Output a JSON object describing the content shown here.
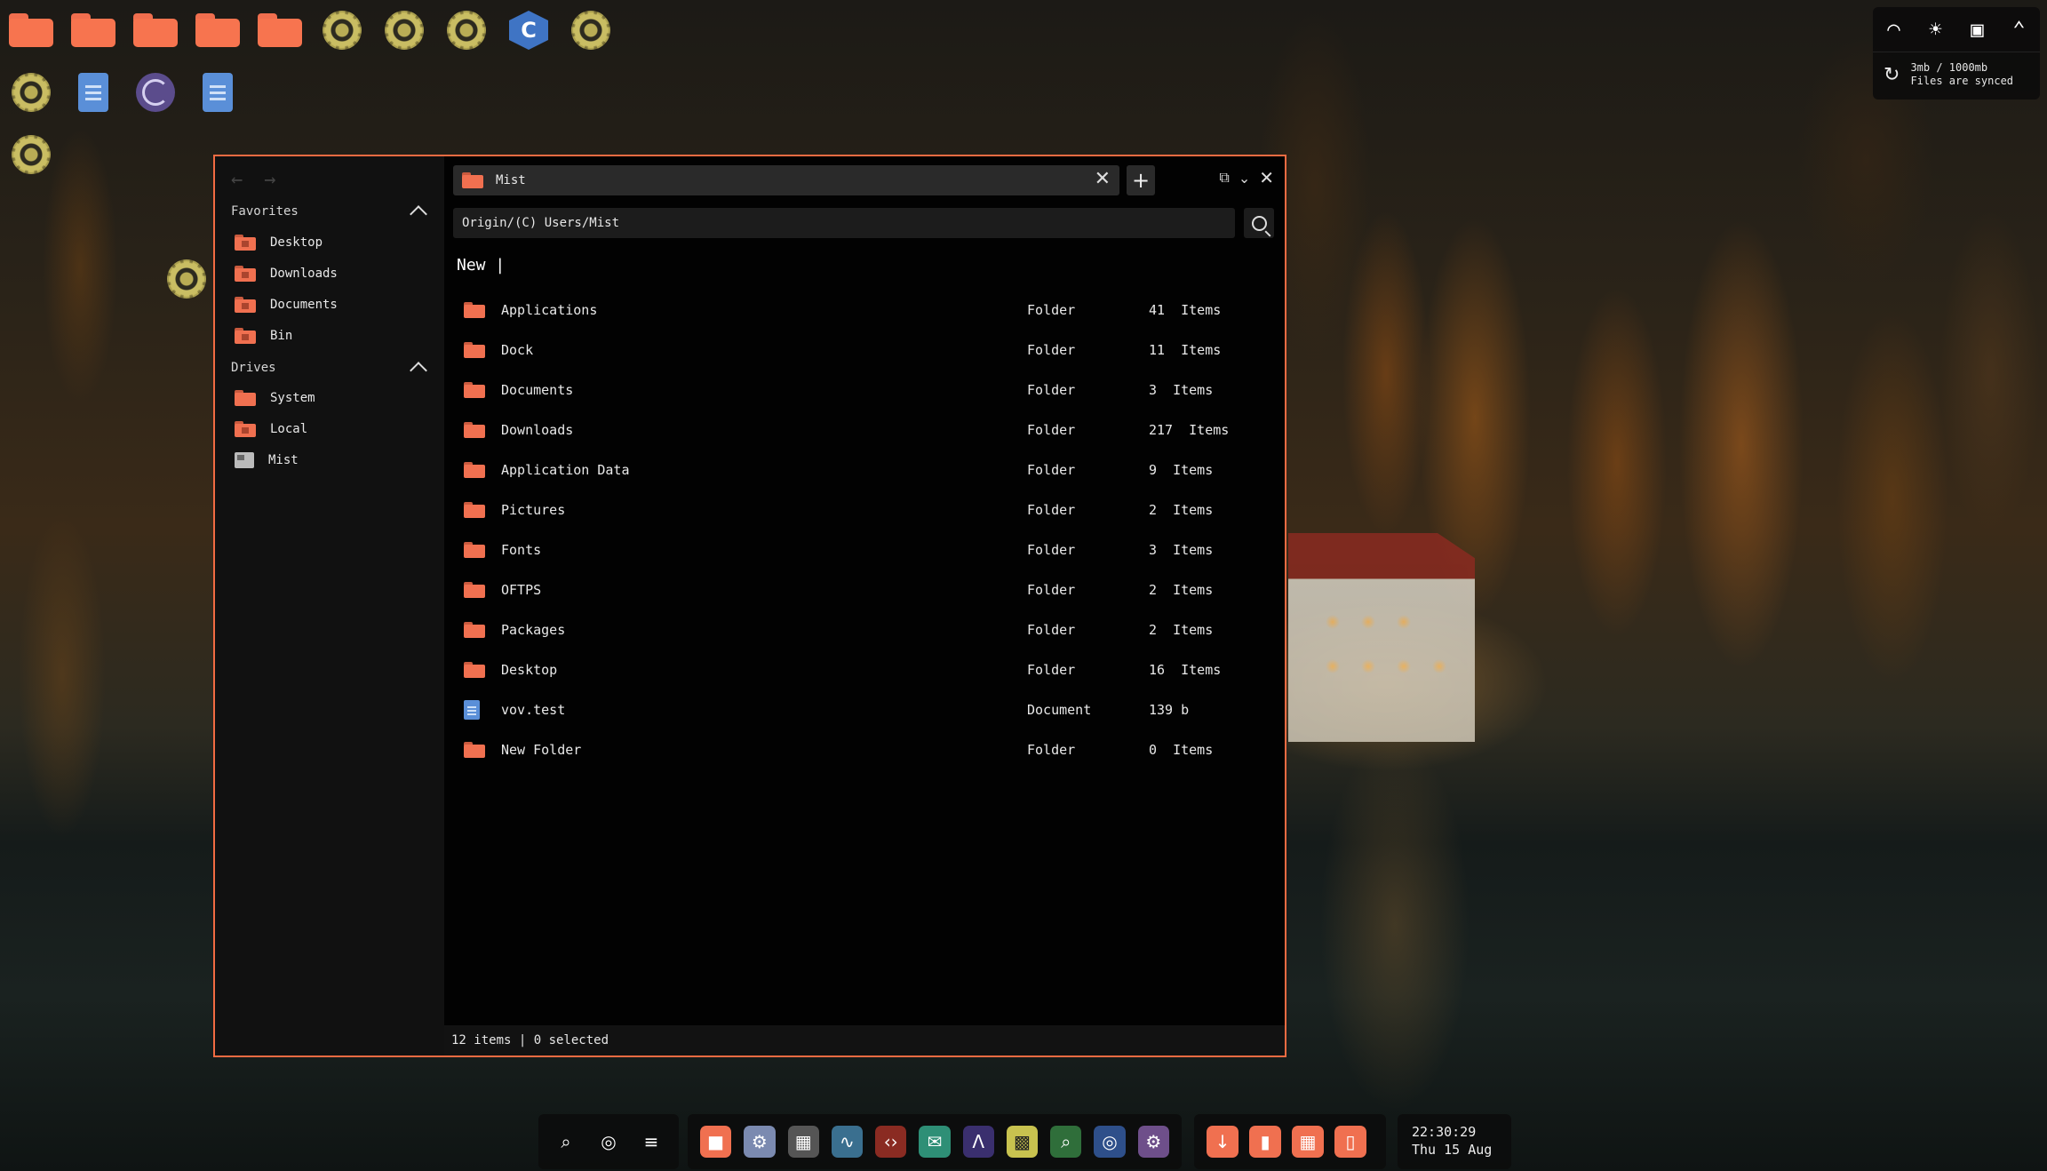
{
  "desktop": {
    "row1": [
      "folder-icon",
      "folder-icon",
      "folder-icon",
      "folder-icon",
      "folder-icon",
      "gear-icon",
      "gear-icon",
      "gear-icon",
      "c-lang-icon",
      "gear-icon"
    ],
    "row2": [
      "gear-icon",
      "document-icon",
      "spiral-icon",
      "document-icon"
    ],
    "c_label": "C"
  },
  "tray": {
    "sync_line1": "3mb / 1000mb",
    "sync_line2": "Files are synced"
  },
  "window": {
    "sidebar": {
      "favorites_label": "Favorites",
      "favorites": [
        "Desktop",
        "Downloads",
        "Documents",
        "Bin"
      ],
      "drives_label": "Drives",
      "drives": [
        "System",
        "Local",
        "Mist"
      ]
    },
    "tab_title": "Mist",
    "path": "Origin/(C) Users/Mist",
    "new_input": "New |",
    "files": [
      {
        "name": "Applications",
        "type": "Folder",
        "count": "41  Items"
      },
      {
        "name": "Dock",
        "type": "Folder",
        "count": "11  Items"
      },
      {
        "name": "Documents",
        "type": "Folder",
        "count": "3  Items"
      },
      {
        "name": "Downloads",
        "type": "Folder",
        "count": "217  Items"
      },
      {
        "name": "Application Data",
        "type": "Folder",
        "count": "9  Items"
      },
      {
        "name": "Pictures",
        "type": "Folder",
        "count": "2  Items"
      },
      {
        "name": "Fonts",
        "type": "Folder",
        "count": "3  Items"
      },
      {
        "name": "OFTPS",
        "type": "Folder",
        "count": "2  Items"
      },
      {
        "name": "Packages",
        "type": "Folder",
        "count": "2  Items"
      },
      {
        "name": "Desktop",
        "type": "Folder",
        "count": "16  Items"
      },
      {
        "name": "vov.test",
        "type": "Document",
        "count": "139 b"
      },
      {
        "name": "New Folder",
        "type": "Folder",
        "count": "0  Items"
      }
    ],
    "status": "12 items | 0 selected"
  },
  "taskbar": {
    "clock_time": "22:30:29",
    "clock_date": "Thu 15 Aug"
  },
  "colors": {
    "accent": "#f16b42",
    "folder": "#f7744f"
  }
}
